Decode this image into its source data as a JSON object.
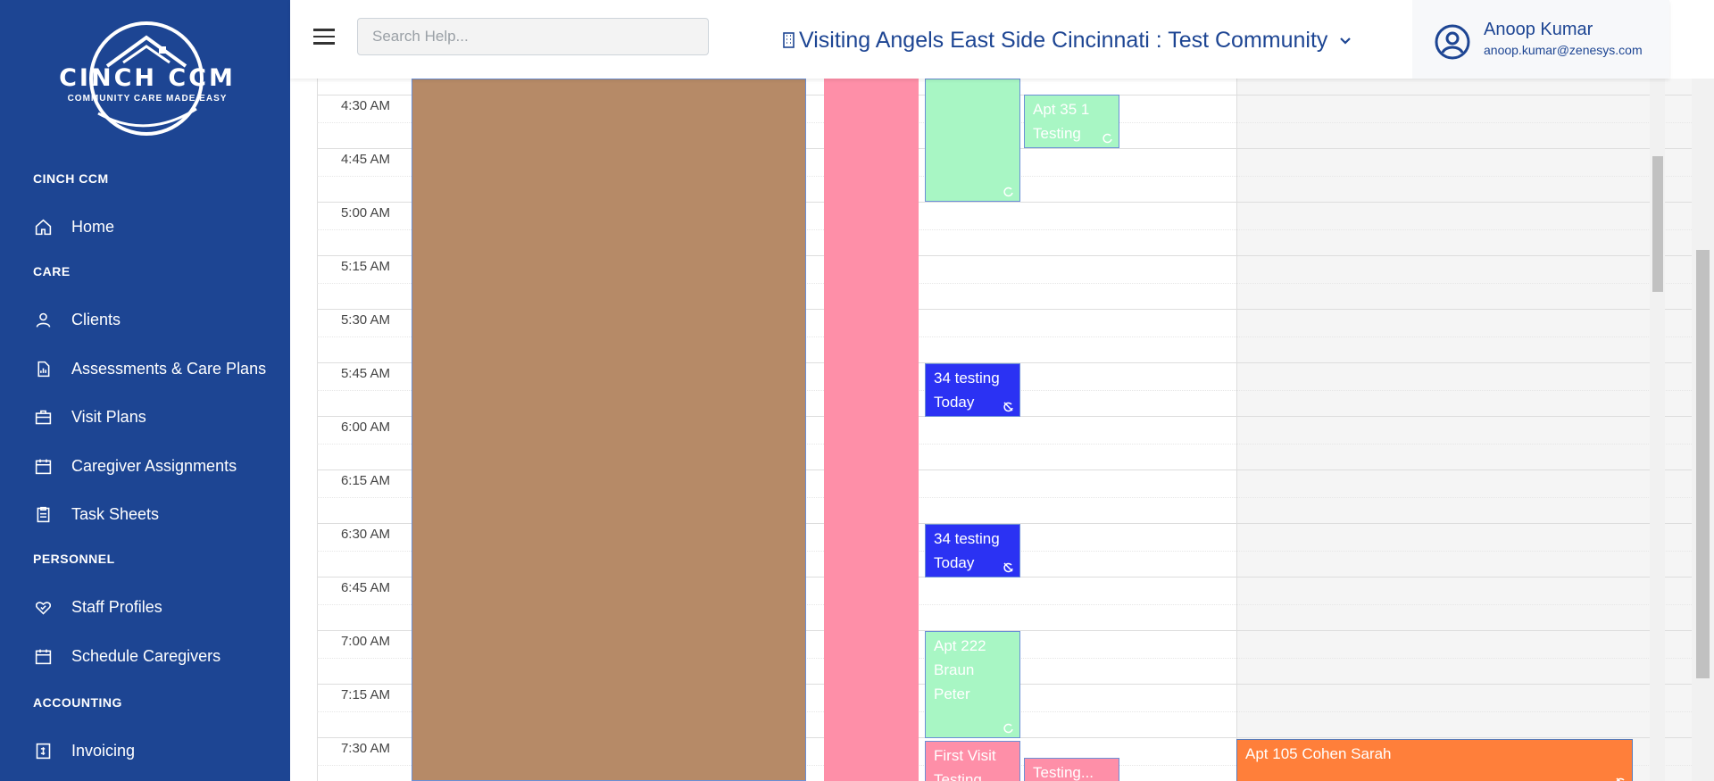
{
  "sidebar": {
    "logo_name": "CINCH CCM",
    "logo_tagline": "COMMUNITY CARE MADE EASY",
    "sections": [
      {
        "label": "CINCH CCM",
        "items": [
          {
            "label": "Home",
            "icon": "home-icon"
          }
        ]
      },
      {
        "label": "CARE",
        "items": [
          {
            "label": "Clients",
            "icon": "user-icon"
          },
          {
            "label": "Assessments & Care Plans",
            "icon": "document-chart-icon"
          },
          {
            "label": "Visit Plans",
            "icon": "briefcase-icon"
          },
          {
            "label": "Caregiver Assignments",
            "icon": "calendar-icon"
          },
          {
            "label": "Task Sheets",
            "icon": "clipboard-icon"
          }
        ]
      },
      {
        "label": "PERSONNEL",
        "items": [
          {
            "label": "Staff Profiles",
            "icon": "heart-hand-icon"
          },
          {
            "label": "Schedule Caregivers",
            "icon": "calendar-icon"
          }
        ]
      },
      {
        "label": "ACCOUNTING",
        "items": [
          {
            "label": "Invoicing",
            "icon": "invoice-icon"
          }
        ]
      }
    ]
  },
  "header": {
    "search_placeholder": "Search Help...",
    "community": "Visiting Angels East Side Cincinnati : Test Community",
    "user_name": "Anoop Kumar",
    "user_email": "anoop.kumar@zenesys.com"
  },
  "calendar": {
    "times": [
      "4:30 AM",
      "4:45 AM",
      "5:00 AM",
      "5:15 AM",
      "5:30 AM",
      "5:45 AM",
      "6:00 AM",
      "6:15 AM",
      "6:30 AM",
      "6:45 AM",
      "7:00 AM",
      "7:15 AM",
      "7:30 AM"
    ],
    "events": [
      {
        "line1": "Apt 35 1",
        "line2": "Testing",
        "color": "#a8f6c4",
        "recurring": true
      },
      {
        "line1": "34 testing",
        "line2": "Today",
        "color": "#2b32f3",
        "recurring": false
      },
      {
        "line1": "34 testing",
        "line2": "Today",
        "color": "#2b32f3",
        "recurring": false
      },
      {
        "line1": "Apt 222",
        "line2": "Braun Peter",
        "color": "#a8f6c4",
        "recurring": true
      },
      {
        "line1": "First Visit",
        "line2": "Testing",
        "color": "#fe8fa8",
        "recurring": false
      },
      {
        "line1": "Testing...",
        "line2": "",
        "color": "#fe8fa8",
        "recurring": false
      },
      {
        "line1": "Apt 105 Cohen Sarah",
        "line2": "",
        "color": "#ff7f3a",
        "recurring": false
      }
    ]
  },
  "colors": {
    "sidebar": "#1d4593",
    "brand_text": "#1d4593",
    "brown_block": "#b68a67",
    "pink_block": "#fe8fa8"
  }
}
